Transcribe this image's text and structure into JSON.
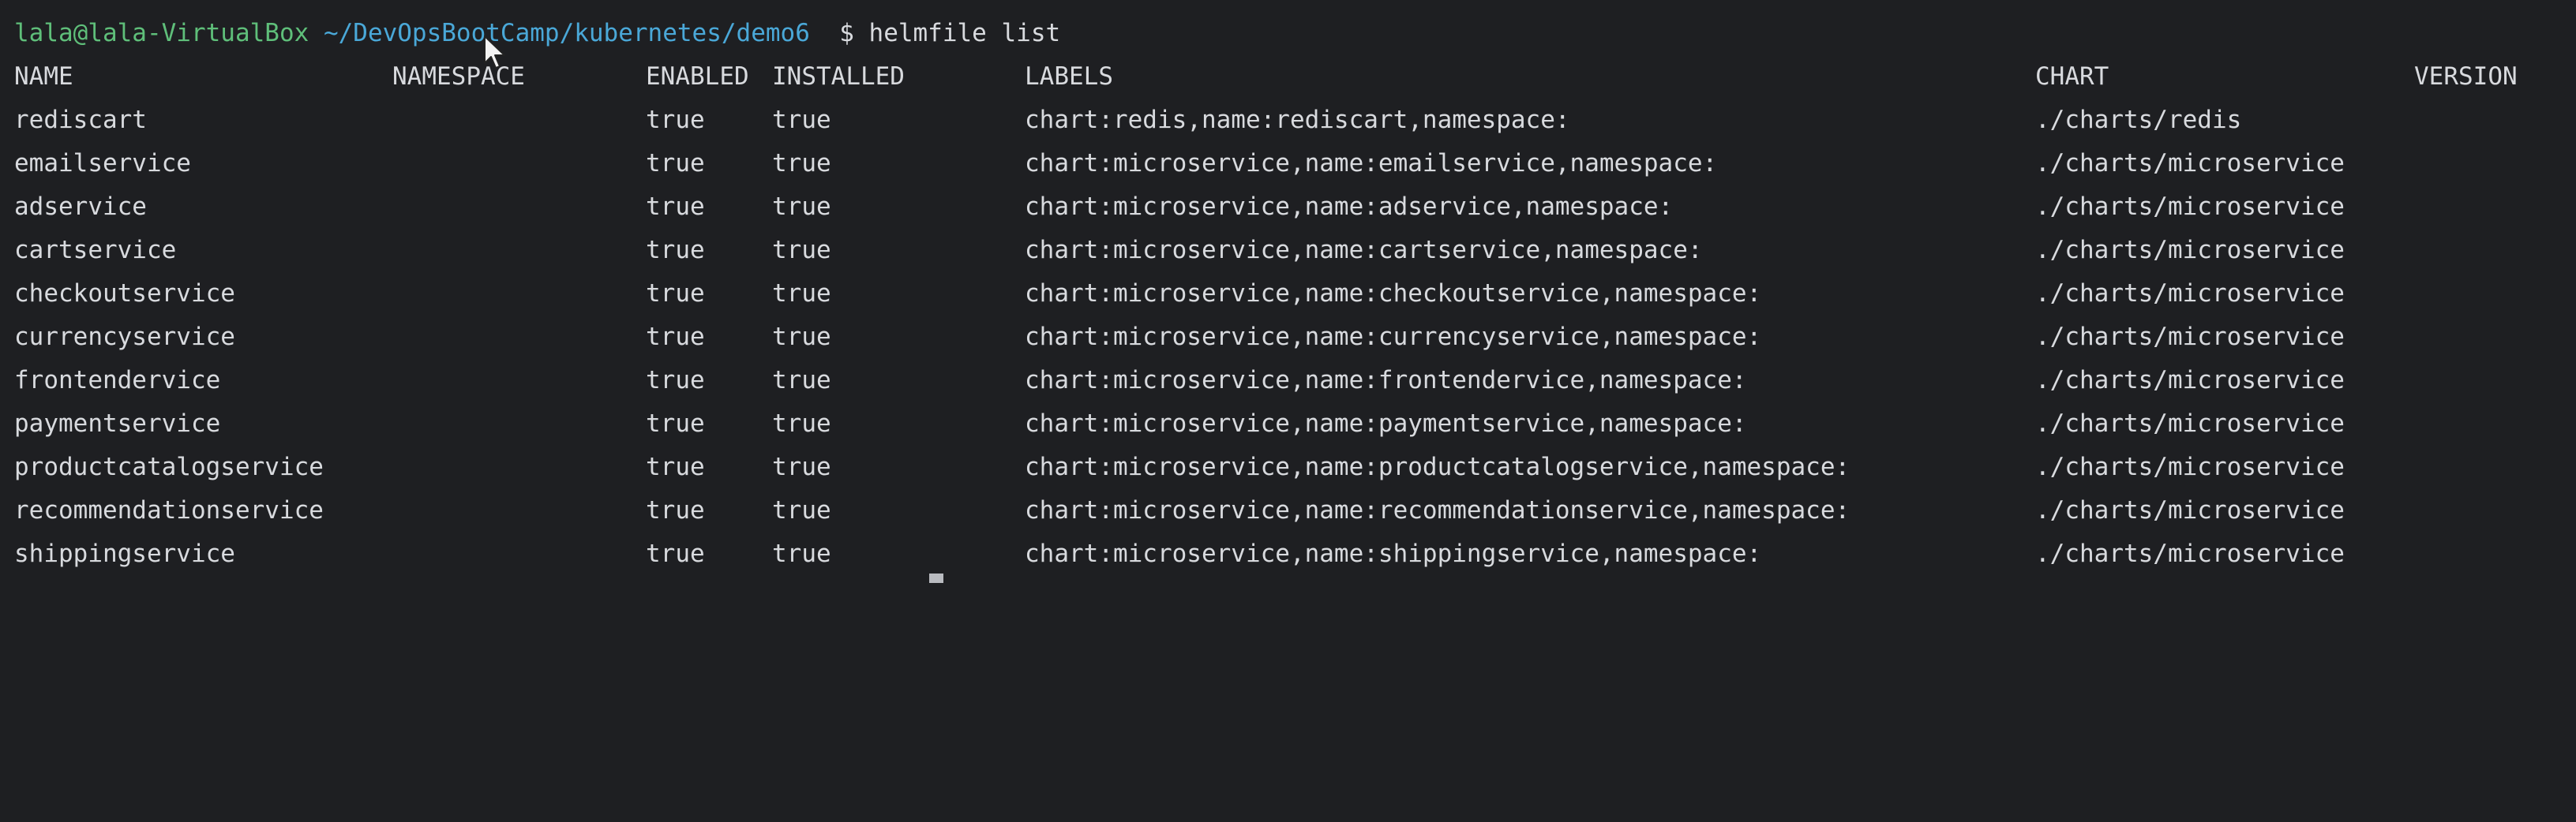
{
  "prompt": {
    "user_host": "lala@lala-VirtualBox",
    "path": "~/DevOpsBootCamp/kubernetes/demo6",
    "symbol": "$",
    "command": "helmfile list"
  },
  "table": {
    "headers": [
      "NAME",
      "NAMESPACE",
      "ENABLED",
      "INSTALLED",
      "LABELS",
      "CHART",
      "VERSION"
    ],
    "rows": [
      [
        "rediscart",
        "",
        "true",
        "true",
        "chart:redis,name:rediscart,namespace:",
        "./charts/redis",
        ""
      ],
      [
        "emailservice",
        "",
        "true",
        "true",
        "chart:microservice,name:emailservice,namespace:",
        "./charts/microservice",
        ""
      ],
      [
        "adservice",
        "",
        "true",
        "true",
        "chart:microservice,name:adservice,namespace:",
        "./charts/microservice",
        ""
      ],
      [
        "cartservice",
        "",
        "true",
        "true",
        "chart:microservice,name:cartservice,namespace:",
        "./charts/microservice",
        ""
      ],
      [
        "checkoutservice",
        "",
        "true",
        "true",
        "chart:microservice,name:checkoutservice,namespace:",
        "./charts/microservice",
        ""
      ],
      [
        "currencyservice",
        "",
        "true",
        "true",
        "chart:microservice,name:currencyservice,namespace:",
        "./charts/microservice",
        ""
      ],
      [
        "frontendervice",
        "",
        "true",
        "true",
        "chart:microservice,name:frontendervice,namespace:",
        "./charts/microservice",
        ""
      ],
      [
        "paymentservice",
        "",
        "true",
        "true",
        "chart:microservice,name:paymentservice,namespace:",
        "./charts/microservice",
        ""
      ],
      [
        "productcatalogservice",
        "",
        "true",
        "true",
        "chart:microservice,name:productcatalogservice,namespace:",
        "./charts/microservice",
        ""
      ],
      [
        "recommendationservice",
        "",
        "true",
        "true",
        "chart:microservice,name:recommendationservice,namespace:",
        "./charts/microservice",
        ""
      ],
      [
        "shippingservice",
        "",
        "true",
        "true",
        "chart:microservice,name:shippingservice,namespace:",
        "./charts/microservice",
        ""
      ]
    ]
  },
  "colors": {
    "background": "#1e1f22",
    "text": "#d8dade",
    "user_host": "#5fbf7a",
    "path": "#4aa8d8"
  },
  "icons": {
    "mouse": "mouse-pointer-icon",
    "cursor": "text-cursor-icon"
  }
}
